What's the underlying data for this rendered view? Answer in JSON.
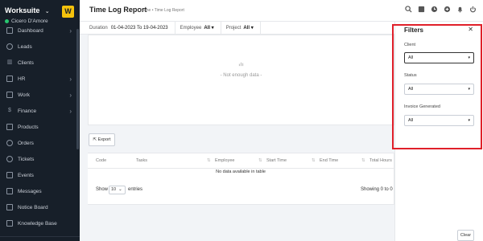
{
  "brand": {
    "name": "Worksuite",
    "user": "Cicero D'Amore",
    "logo_letter": "W"
  },
  "sidebar": {
    "items": [
      {
        "label": "Dashboard",
        "icon": "home-icon",
        "has_chevron": true
      },
      {
        "label": "Leads",
        "icon": "leads-icon",
        "has_chevron": false
      },
      {
        "label": "Clients",
        "icon": "clients-icon",
        "has_chevron": false
      },
      {
        "label": "HR",
        "icon": "hr-icon",
        "has_chevron": true
      },
      {
        "label": "Work",
        "icon": "work-icon",
        "has_chevron": true
      },
      {
        "label": "Finance",
        "icon": "dollar-icon",
        "has_chevron": true
      },
      {
        "label": "Products",
        "icon": "products-icon",
        "has_chevron": false
      },
      {
        "label": "Orders",
        "icon": "orders-icon",
        "has_chevron": false
      },
      {
        "label": "Tickets",
        "icon": "tickets-icon",
        "has_chevron": false
      },
      {
        "label": "Events",
        "icon": "events-icon",
        "has_chevron": false
      },
      {
        "label": "Messages",
        "icon": "messages-icon",
        "has_chevron": false
      },
      {
        "label": "Notice Board",
        "icon": "notice-icon",
        "has_chevron": false
      },
      {
        "label": "Knowledge Base",
        "icon": "knowledge-icon",
        "has_chevron": false
      }
    ]
  },
  "header": {
    "title": "Time Log Report",
    "breadcrumb": "Home • Time Log Report"
  },
  "filterbar": {
    "duration_label": "Duration",
    "duration_value": "01-04-2023 To 19-04-2023",
    "employee_label": "Employee",
    "employee_value": "All",
    "project_label": "Project",
    "project_value": "All"
  },
  "chart": {
    "empty_text": "- Not enough data -"
  },
  "export_label": "Export",
  "table": {
    "columns": [
      "Code",
      "Tasks",
      "Employee",
      "Start Time",
      "End Time",
      "Total Hours"
    ],
    "empty_text": "No data available in table",
    "show_label": "Show",
    "entries_value": "10",
    "entries_label": "entries",
    "showing_text": "Showing 0 to 0"
  },
  "filters_panel": {
    "title": "Filters",
    "client_label": "Client",
    "client_value": "All",
    "status_label": "Status",
    "status_value": "All",
    "invoice_label": "Invoice Generated",
    "invoice_value": "All",
    "clear_label": "Clear"
  },
  "colors": {
    "sidebar_bg": "#171f29",
    "logo": "#f5c20c",
    "highlight": "#e0202a",
    "online": "#28c76f"
  }
}
